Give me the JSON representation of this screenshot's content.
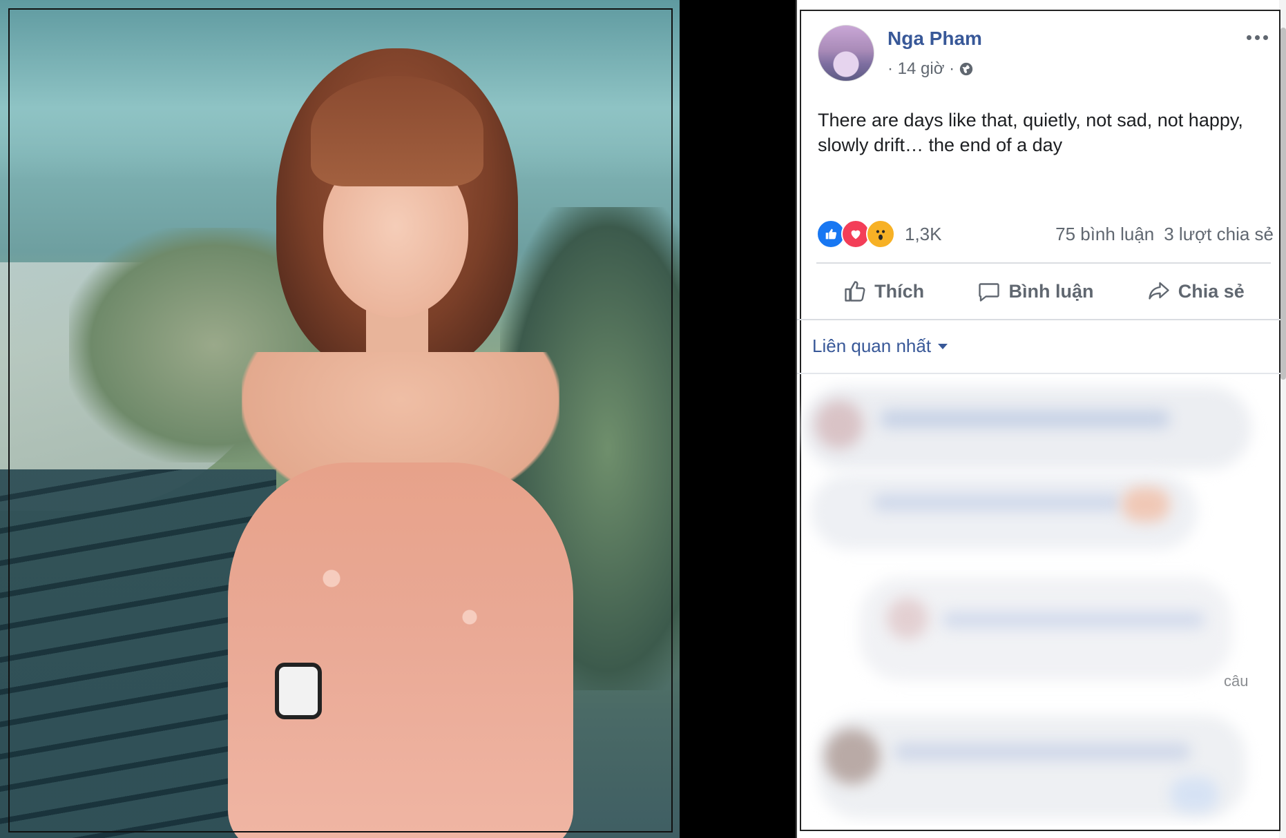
{
  "post": {
    "author": "Nga Pham",
    "time": "· 14 giờ ·",
    "text": "There are days like that, quietly, not sad, not happy, slowly drift… the end of a day",
    "reaction_count": "1,3K",
    "comments": "75 bình luận",
    "shares": "3 lượt chia sẻ"
  },
  "actions": {
    "like": "Thích",
    "comment": "Bình luận",
    "share": "Chia sẻ"
  },
  "comments_section": {
    "sort_label": "Liên quan nhất",
    "partial_text": "câu"
  },
  "icons": {
    "more": "more-options-icon",
    "globe": "globe-icon",
    "like_reaction": "like-reaction-icon",
    "love_reaction": "love-reaction-icon",
    "wow_reaction": "wow-reaction-icon"
  },
  "colors": {
    "link_blue": "#385898",
    "meta_gray": "#606770",
    "like_blue": "#1877f2",
    "love_red": "#f33e58",
    "wow_yellow": "#f7b125"
  }
}
